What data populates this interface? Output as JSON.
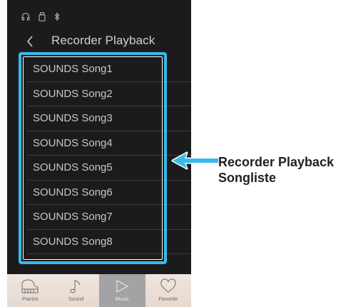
{
  "header": {
    "title": "Recorder Playback"
  },
  "songs": [
    "SOUNDS Song1",
    "SOUNDS Song2",
    "SOUNDS Song3",
    "SOUNDS Song4",
    "SOUNDS Song5",
    "SOUNDS Song6",
    "SOUNDS Song7",
    "SOUNDS Song8"
  ],
  "tabs": [
    {
      "label": "Pianist",
      "icon": "piano-icon",
      "active": false
    },
    {
      "label": "Sound",
      "icon": "music-note-icon",
      "active": false
    },
    {
      "label": "Music",
      "icon": "play-icon",
      "active": true
    },
    {
      "label": "Favorite",
      "icon": "heart-icon",
      "active": false
    }
  ],
  "callout": {
    "line1": "Recorder Playback",
    "line2": "Songliste"
  },
  "colors": {
    "highlight": "#38b9e8",
    "background": "#1b1b1d",
    "tabbar": "#e9ddd4"
  }
}
